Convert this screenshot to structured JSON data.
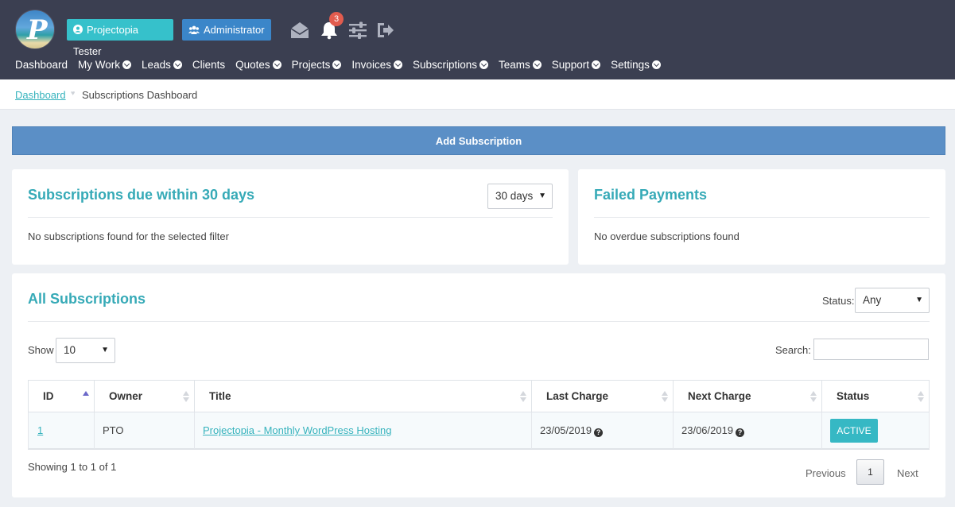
{
  "header": {
    "logo_letter": "P",
    "user_label": "Projectopia Tester",
    "role_label": "Administrator",
    "notification_count": "3",
    "icons": [
      "envelope-open-icon",
      "bell-icon",
      "sliders-icon",
      "sign-out-icon"
    ]
  },
  "nav": {
    "items": [
      {
        "label": "Dashboard",
        "dropdown": false
      },
      {
        "label": "My Work",
        "dropdown": true
      },
      {
        "label": "Leads",
        "dropdown": true
      },
      {
        "label": "Clients",
        "dropdown": false
      },
      {
        "label": "Quotes",
        "dropdown": true
      },
      {
        "label": "Projects",
        "dropdown": true
      },
      {
        "label": "Invoices",
        "dropdown": true
      },
      {
        "label": "Subscriptions",
        "dropdown": true
      },
      {
        "label": "Teams",
        "dropdown": true
      },
      {
        "label": "Support",
        "dropdown": true
      },
      {
        "label": "Settings",
        "dropdown": true
      }
    ]
  },
  "breadcrumb": {
    "home": "Dashboard",
    "current": "Subscriptions Dashboard"
  },
  "add_button": "Add Subscription",
  "due_panel": {
    "title": "Subscriptions due within 30 days",
    "filter_value": "30 days",
    "empty_text": "No subscriptions found for the selected filter"
  },
  "failed_panel": {
    "title": "Failed Payments",
    "empty_text": "No overdue subscriptions found"
  },
  "all_panel": {
    "title": "All Subscriptions",
    "status_label": "Status:",
    "status_value": "Any",
    "show_label": "Show",
    "show_value": "10",
    "search_label": "Search:",
    "search_value": "",
    "columns": [
      "ID",
      "Owner",
      "Title",
      "Last Charge",
      "Next Charge",
      "Status"
    ],
    "rows": [
      {
        "id": "1",
        "owner": "PTO",
        "title": "Projectopia - Monthly WordPress Hosting",
        "last_charge": "23/05/2019",
        "next_charge": "23/06/2019",
        "status": "ACTIVE"
      }
    ],
    "info": "Showing 1 to 1 of 1",
    "pager": {
      "previous": "Previous",
      "page": "1",
      "next": "Next"
    }
  },
  "colors": {
    "header_bg": "#3b3f51",
    "accent_teal": "#36b3bd",
    "add_button_bg": "#5b8fc6",
    "badge_red": "#e25c4e",
    "admin_blue": "#3b86c9"
  }
}
